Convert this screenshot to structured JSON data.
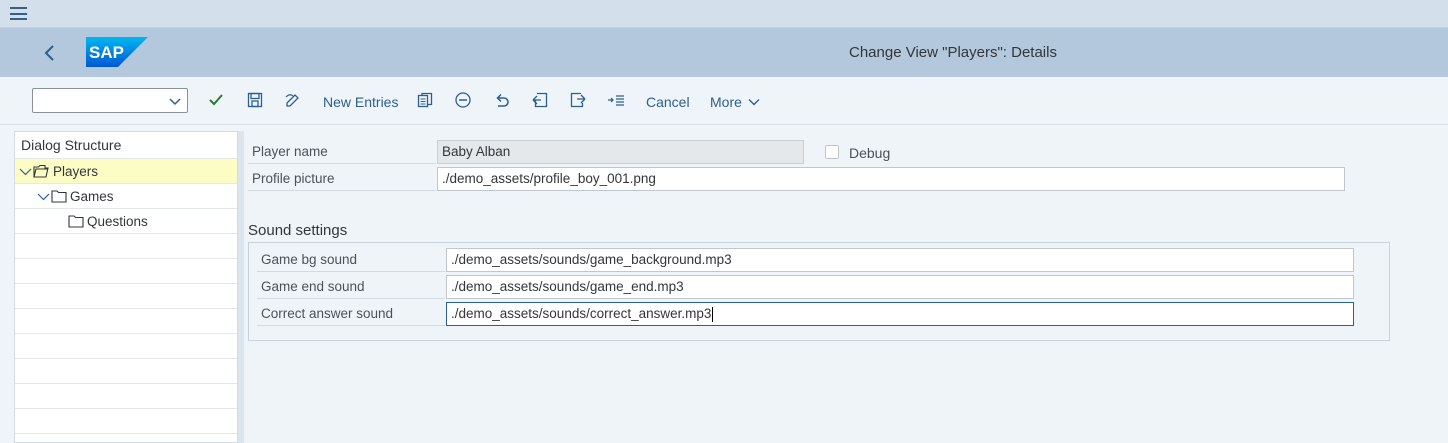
{
  "title": "Change View \"Players\": Details",
  "logo_text": "SAP",
  "toolbar": {
    "command_field_value": "",
    "new_entries": "New Entries",
    "cancel": "Cancel",
    "more": "More"
  },
  "tree": {
    "header": "Dialog Structure",
    "items": [
      {
        "label": "Players",
        "level": 0,
        "expanded": true,
        "selected": true
      },
      {
        "label": "Games",
        "level": 1,
        "expanded": true,
        "selected": false
      },
      {
        "label": "Questions",
        "level": 2,
        "expanded": false,
        "selected": false
      }
    ]
  },
  "form": {
    "player_name_label": "Player name",
    "player_name_value": "Baby Alban",
    "debug_label": "Debug",
    "debug_checked": false,
    "profile_picture_label": "Profile picture",
    "profile_picture_value": "./demo_assets/profile_boy_001.png"
  },
  "sound_settings": {
    "title": "Sound settings",
    "game_bg_label": "Game bg sound",
    "game_bg_value": "./demo_assets/sounds/game_background.mp3",
    "game_end_label": "Game end sound",
    "game_end_value": "./demo_assets/sounds/game_end.mp3",
    "correct_label": "Correct answer sound",
    "correct_value": "./demo_assets/sounds/correct_answer.mp3"
  },
  "colors": {
    "accent": "#2b5f8f",
    "shell": "#b3c8dc",
    "selected_row": "#fcfdc4",
    "check_green": "#2b7d2b"
  }
}
